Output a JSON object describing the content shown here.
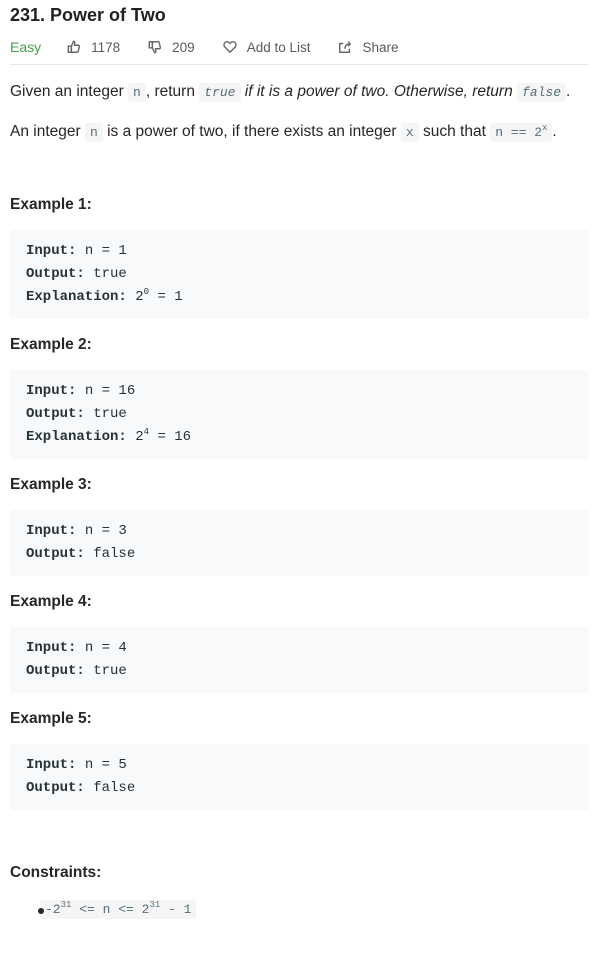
{
  "problem": {
    "title": "231. Power of Two",
    "difficulty": "Easy",
    "likes": "1178",
    "dislikes": "209",
    "add_to_list": "Add to List",
    "share": "Share",
    "accent_easy": "#43a047"
  },
  "description": {
    "p1_a": "Given an integer ",
    "p1_code_n": "n",
    "p1_b": ", return ",
    "p1_code_true": "true",
    "p1_italic": " if it is a power of two. Otherwise, return ",
    "p1_code_false": "false",
    "p1_end": ".",
    "p2_a": "An integer ",
    "p2_code_n": "n",
    "p2_b": " is a power of two, if there exists an integer ",
    "p2_code_x": "x",
    "p2_c": " such that ",
    "p2_code_expr": "n == 2",
    "p2_code_sup": "x",
    "p2_end": "."
  },
  "labels": {
    "input": "Input:",
    "output": "Output:",
    "explanation": "Explanation:"
  },
  "examples": [
    {
      "title": "Example 1:",
      "input": "n = 1",
      "output": "true",
      "exp_base": "2",
      "exp_sup": "0",
      "exp_rest": " = 1"
    },
    {
      "title": "Example 2:",
      "input": "n = 16",
      "output": "true",
      "exp_base": "2",
      "exp_sup": "4",
      "exp_rest": " = 16"
    },
    {
      "title": "Example 3:",
      "input": "n = 3",
      "output": "false"
    },
    {
      "title": "Example 4:",
      "input": "n = 4",
      "output": "true"
    },
    {
      "title": "Example 5:",
      "input": "n = 5",
      "output": "false"
    }
  ],
  "constraints": {
    "title": "Constraints:",
    "c1_a": "-2",
    "c1_sup1": "31",
    "c1_b": " <= n <= 2",
    "c1_sup2": "31",
    "c1_c": " - 1"
  }
}
